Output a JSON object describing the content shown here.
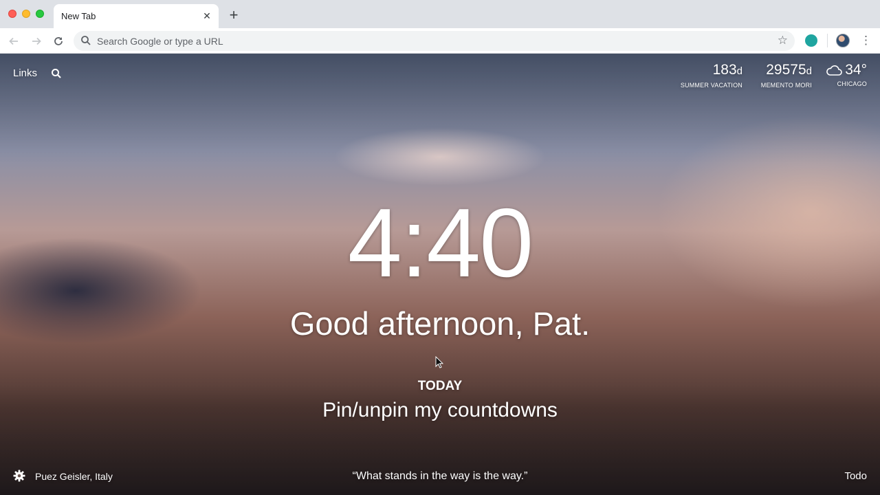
{
  "browser": {
    "tab_title": "New Tab",
    "tab_close": "✕",
    "new_tab": "+",
    "omnibox_placeholder": "Search Google or type a URL"
  },
  "topleft": {
    "links_label": "Links"
  },
  "metrics": [
    {
      "value": "183",
      "unit": "d",
      "label": "SUMMER VACATION"
    },
    {
      "value": "29575",
      "unit": "d",
      "label": "MEMENTO MORI"
    },
    {
      "value": "34°",
      "label": "CHICAGO",
      "icon": "cloud-icon"
    }
  ],
  "main": {
    "time": "4:40",
    "greeting": "Good afternoon, Pat.",
    "focus_label": "TODAY",
    "focus_text": "Pin/unpin my countdowns"
  },
  "footer": {
    "photo_location": "Puez Geisler, Italy",
    "quote": "“What stands in the way is the way.”",
    "todo_label": "Todo"
  },
  "colors": {
    "accent_extension": "#1fa5a0",
    "text_on_background": "#ffffff"
  }
}
